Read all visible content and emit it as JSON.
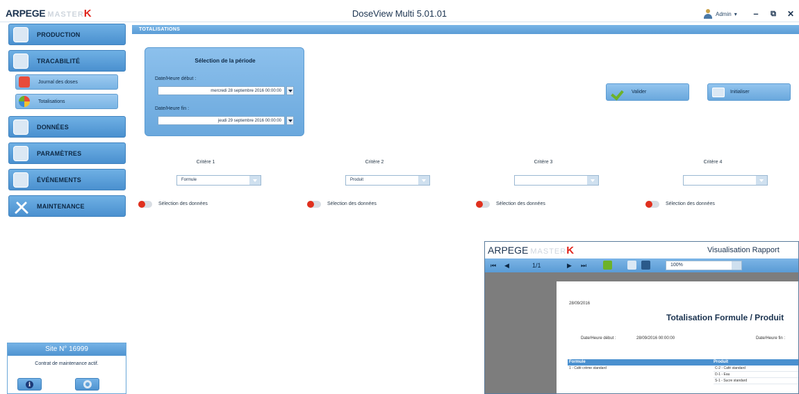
{
  "window": {
    "title": "DoseView Multi 5.01.01",
    "logo": {
      "brand": "ARPEGE",
      "sub": "MASTER",
      "k": "K"
    },
    "user": "Admin",
    "user_caret": "▾",
    "minimize": "–",
    "restore": "⧉",
    "close": "✕"
  },
  "sidebar": {
    "production": "PRODUCTION",
    "tracabilite": "TRACABILITÉ",
    "journal": "Journal des doses",
    "totalisations": "Totalisations",
    "donnees": "DONNÉES",
    "parametres": "PARAMÈTRES",
    "evenements": "ÉVÉNEMENTS",
    "maintenance": "MAINTENANCE"
  },
  "site": {
    "title": "Site N° 16999",
    "message": "Contrat de maintenance actif.",
    "info_glyph": "i"
  },
  "section": {
    "title": "TOTALISATIONS"
  },
  "period": {
    "title": "Sélection de la période",
    "start_label": "Date/Heure début :",
    "start_value": "mercredi 28 septembre 2016 00:00:00",
    "end_label": "Date/Heure fin :",
    "end_value": "jeudi 29 septembre 2016 00:00:00"
  },
  "actions": {
    "validate": "Valider",
    "reset": "Initialiser"
  },
  "criteria": [
    {
      "label": "Critère 1",
      "value": "Formule",
      "toggle_label": "Sélection des données"
    },
    {
      "label": "Critère 2",
      "value": "Produit",
      "toggle_label": "Sélection des données"
    },
    {
      "label": "Critère 3",
      "value": "",
      "toggle_label": "Sélection des données"
    },
    {
      "label": "Critère 4",
      "value": "",
      "toggle_label": "Sélection des données"
    }
  ],
  "report": {
    "logo": {
      "brand": "ARPEGE",
      "sub": "MASTER",
      "k": "K"
    },
    "title": "Visualisation Rapport",
    "toolbar": {
      "first": "⏮",
      "prev": "◀",
      "page": "1/1",
      "next": "▶",
      "last": "⏭",
      "zoom": "100%"
    },
    "page": {
      "date": "28/09/2016",
      "title": "Totalisation Formule / Produit",
      "start_label": "Date/Heure début :",
      "start_value": "28/09/2016 00:00:00",
      "end_label": "Date/Heure fin :",
      "col_formula": "Formule",
      "col_product": "Produit",
      "rows": [
        {
          "formula": "1 - Café crème standard",
          "product": "C-2 - Café standard"
        },
        {
          "formula": "",
          "product": "D-1 - Eau"
        },
        {
          "formula": "",
          "product": "S-1 - Sucre standard"
        }
      ]
    }
  }
}
